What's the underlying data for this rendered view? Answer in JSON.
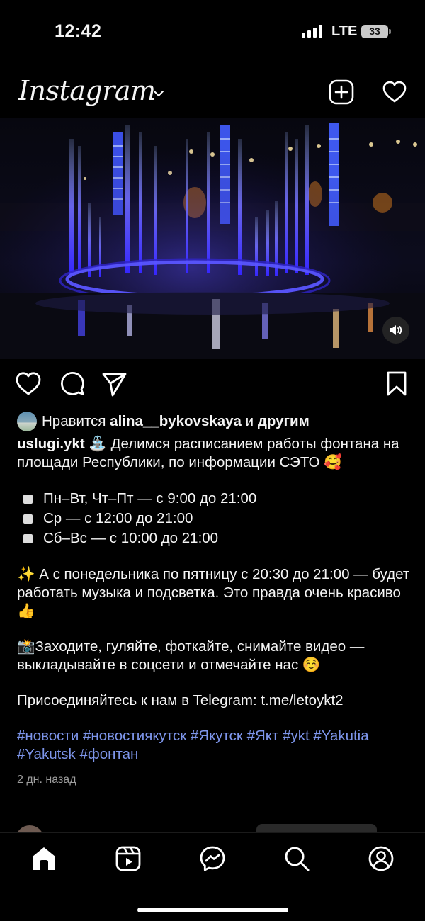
{
  "status": {
    "time": "12:42",
    "network": "LTE",
    "battery": "33"
  },
  "header": {
    "logo": "Instagram",
    "icons": [
      "chevron-down-icon",
      "new-post-icon",
      "heart-icon"
    ]
  },
  "media": {
    "type": "video",
    "icons": [
      "volume-icon"
    ]
  },
  "actions": {
    "icons": [
      "heart-icon",
      "comment-icon",
      "share-icon",
      "bookmark-icon"
    ]
  },
  "post": {
    "likes_prefix": "Нравится",
    "liked_by": "alina__bykovskaya",
    "likes_and": "и",
    "likes_others": "другим",
    "username": "uslugi.ykt",
    "caption_intro": "⛲ Делимся расписанием работы фонтана на площади Республики, по информации СЭТО 🥰",
    "schedule": [
      "Пн–Вт, Чт–Пт — с 9:00 до 21:00",
      "Ср — с 12:00 до 21:00",
      "Сб–Вс — с 10:00 до 21:00"
    ],
    "music_note": "✨ А с понедельника по пятницу с 20:30 до 21:00 — будет работать музыка и подсветка. Это правда очень красиво 👍",
    "invite": "📸Заходите, гуляйте, фоткайте, снимайте видео — выкладывайте в соцсети и отмечайте нас ☺️",
    "telegram": "Присоединяйтесь к нам в Telegram: t.me/letoykt2",
    "hashtags": "#новости #новостиякутск #Якутск #Якт #ykt #Yakutia #Yakutsk #фонтан",
    "time_ago": "2 дн. назад"
  },
  "tabbar": {
    "icons": [
      "home-icon",
      "reels-icon",
      "messenger-icon",
      "search-icon",
      "profile-icon"
    ]
  },
  "colors": {
    "background": "#000000",
    "text": "#f5f5f5",
    "hashtag": "#7d95ea",
    "muted": "#9e9e9e"
  }
}
